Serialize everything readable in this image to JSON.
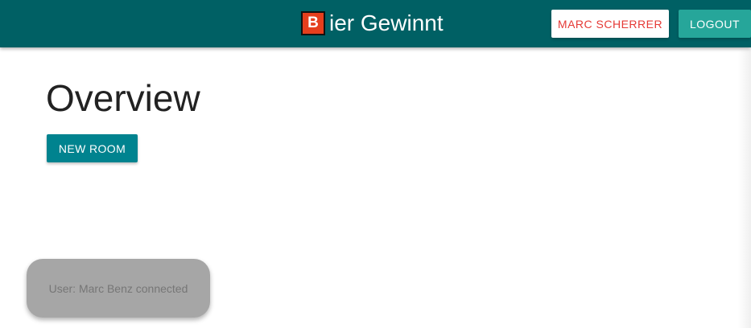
{
  "navbar": {
    "brand_logo_letter": "B",
    "brand_text": "ier Gewinnt",
    "user_button_label": "MARC SCHERRER",
    "logout_button_label": "LOGOUT"
  },
  "main": {
    "title": "Overview",
    "new_room_label": "NEW ROOM"
  },
  "toast": {
    "message": "User: Marc Benz connected"
  },
  "colors": {
    "navbar": "#006064",
    "logo": "#e53f1d",
    "user_button_text": "#e53935",
    "logout_button": "#26a69a",
    "new_room_button": "#00838f",
    "toast_background": "#a6a6a6"
  }
}
